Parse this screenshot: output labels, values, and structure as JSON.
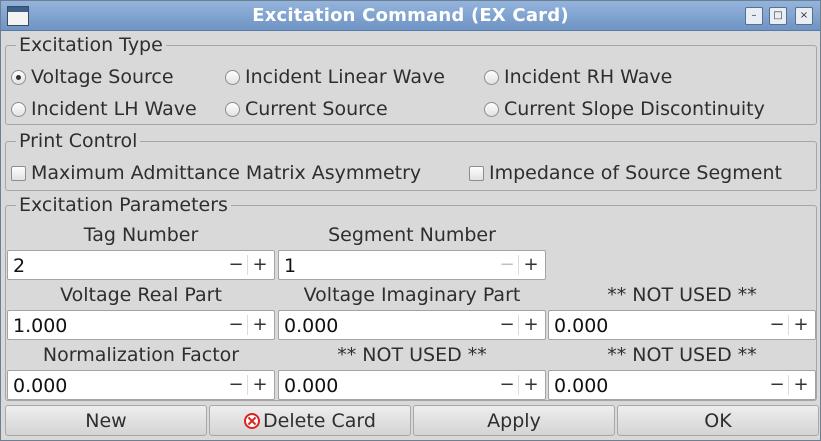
{
  "window": {
    "title": "Excitation Command (EX Card)",
    "min_glyph": "–",
    "max_glyph": "□",
    "close_glyph": "×"
  },
  "excitation_type": {
    "title": "Excitation Type",
    "options": [
      {
        "label": "Voltage Source",
        "selected": true
      },
      {
        "label": "Incident Linear Wave",
        "selected": false
      },
      {
        "label": "Incident RH Wave",
        "selected": false
      },
      {
        "label": "Incident LH Wave",
        "selected": false
      },
      {
        "label": "Current Source",
        "selected": false
      },
      {
        "label": "Current Slope Discontinuity",
        "selected": false
      }
    ]
  },
  "print_control": {
    "title": "Print Control",
    "options": [
      {
        "label": "Maximum Admittance Matrix Asymmetry",
        "checked": false
      },
      {
        "label": "Impedance of Source Segment",
        "checked": false
      }
    ]
  },
  "parameters": {
    "title": "Excitation Parameters",
    "tag_number": {
      "label": "Tag Number",
      "value": "2"
    },
    "segment_number": {
      "label": "Segment Number",
      "value": "1"
    },
    "voltage_real": {
      "label": "Voltage Real Part",
      "value": "1.000"
    },
    "voltage_imag": {
      "label": "Voltage Imaginary Part",
      "value": "0.000"
    },
    "not_used_1": {
      "label": "** NOT USED **",
      "value": "0.000"
    },
    "normalization": {
      "label": "Normalization Factor",
      "value": "0.000"
    },
    "not_used_2": {
      "label": "** NOT USED **",
      "value": "0.000"
    },
    "not_used_3": {
      "label": "** NOT USED **",
      "value": "0.000"
    },
    "dec_glyph": "−",
    "inc_glyph": "+"
  },
  "buttons": {
    "new": "New",
    "delete": "Delete Card",
    "apply": "Apply",
    "ok": "OK"
  }
}
